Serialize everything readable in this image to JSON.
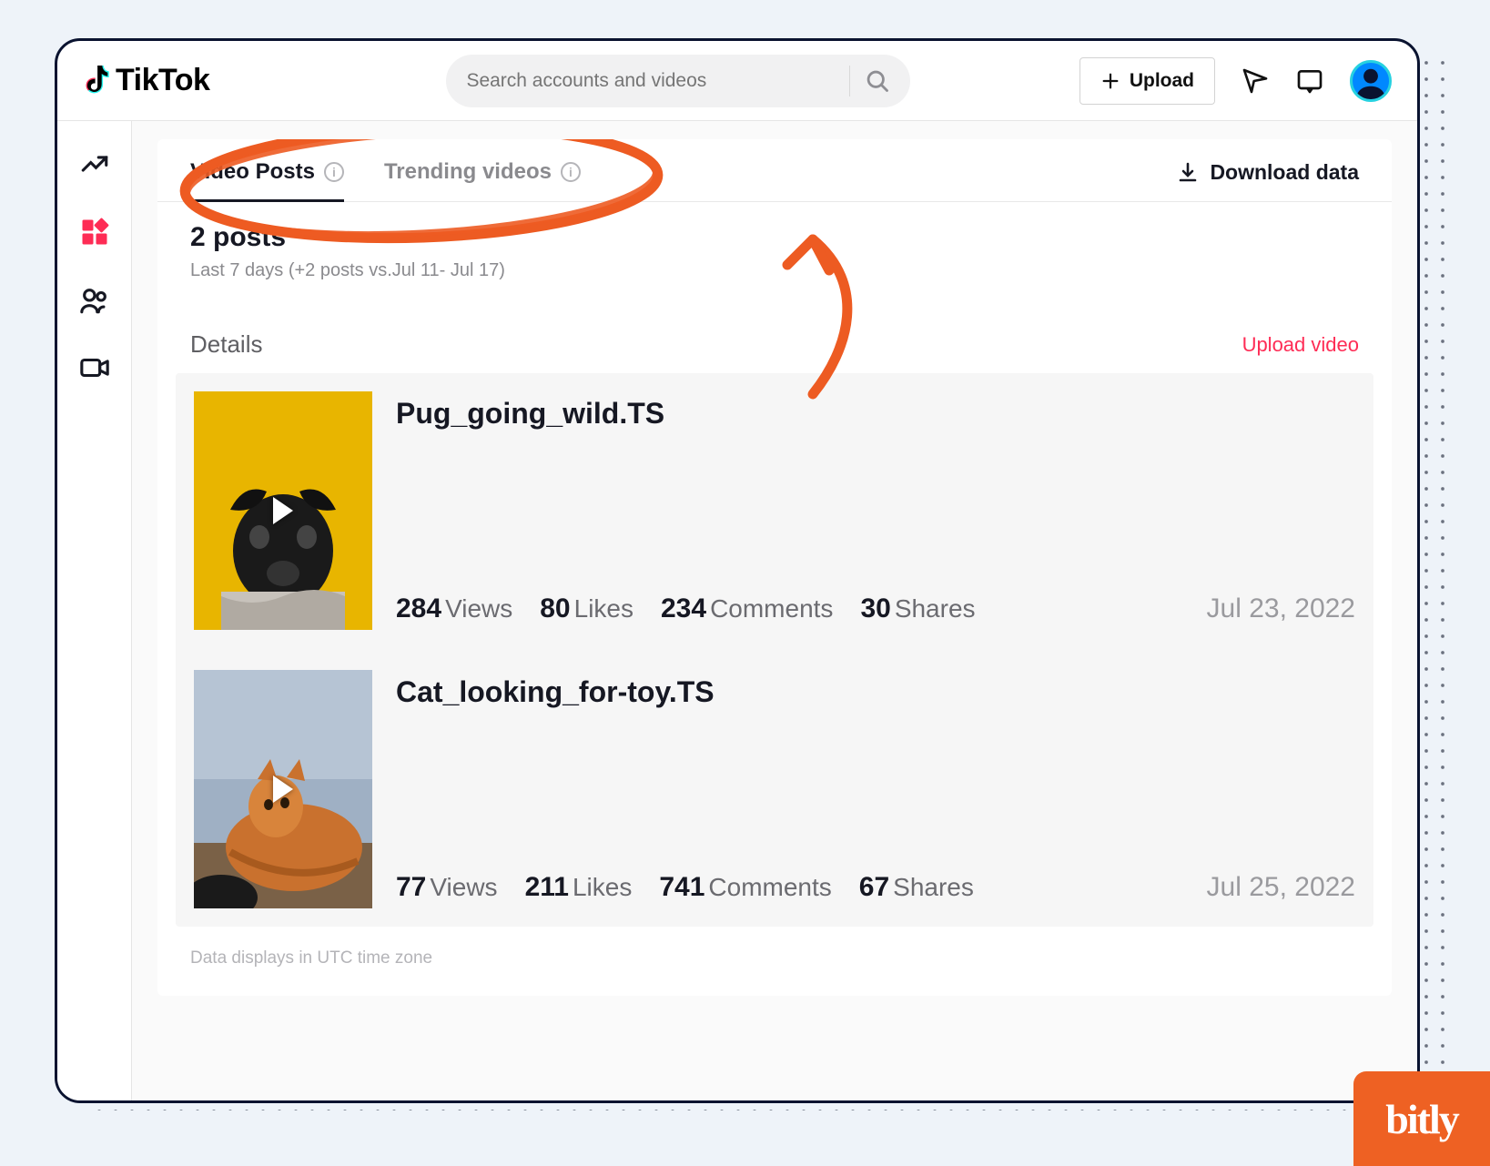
{
  "brand": "TikTok",
  "search": {
    "placeholder": "Search accounts and videos"
  },
  "header": {
    "upload_label": "Upload"
  },
  "tabs": {
    "video_posts": "Video Posts",
    "trending": "Trending videos",
    "download": "Download data"
  },
  "summary": {
    "count": "2",
    "count_label": "posts",
    "sub": "Last 7 days (+2 posts vs.Jul 11- Jul 17)"
  },
  "details": {
    "label": "Details",
    "upload_link": "Upload video"
  },
  "videos": [
    {
      "title": "Pug_going_wild.TS",
      "views": "284",
      "views_label": "Views",
      "likes": "80",
      "likes_label": "Likes",
      "comments": "234",
      "comments_label": "Comments",
      "shares": "30",
      "shares_label": "Shares",
      "date": "Jul 23, 2022"
    },
    {
      "title": "Cat_looking_for-toy.TS",
      "views": "77",
      "views_label": "Views",
      "likes": "211",
      "likes_label": "Likes",
      "comments": "741",
      "comments_label": "Comments",
      "shares": "67",
      "shares_label": "Shares",
      "date": "Jul 25, 2022"
    }
  ],
  "footer_note": "Data displays in UTC time zone",
  "bitly": "bitly",
  "icons": {
    "analytics": "analytics-icon",
    "grid": "grid-icon",
    "users": "users-icon",
    "video": "video-icon"
  }
}
